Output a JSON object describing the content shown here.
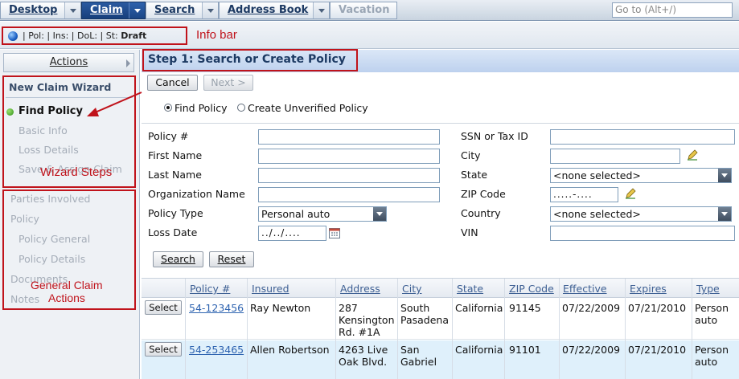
{
  "tabs": [
    {
      "label": "Desktop",
      "state": "normal"
    },
    {
      "label": "Claim",
      "state": "active"
    },
    {
      "label": "Search",
      "state": "normal"
    },
    {
      "label": "Address Book",
      "state": "normal"
    },
    {
      "label": "Vacation",
      "state": "disabled"
    }
  ],
  "goto": {
    "placeholder": "Go to (Alt+/)"
  },
  "infobar": {
    "text": "| Pol: | Ins: | DoL: | St: ",
    "status": "Draft",
    "callout": "Info bar"
  },
  "sidebar": {
    "actions_label": "Actions",
    "wizard_title": "New Claim Wizard",
    "wizard_steps": [
      "Find Policy",
      "Basic Info",
      "Loss Details",
      "Save & Assign Claim"
    ],
    "wizard_callout": "Wizard Steps",
    "general_items": [
      "Parties Involved",
      "Policy",
      "Policy General",
      "Policy Details",
      "Documents",
      "Notes"
    ],
    "general_callout_line1": "General Claim",
    "general_callout_line2": "Actions"
  },
  "step": {
    "title": "Step 1: Search or Create Policy"
  },
  "buttons": {
    "cancel": "Cancel",
    "next": "Next >",
    "search": "Search",
    "reset": "Reset"
  },
  "mode": {
    "find": "Find Policy",
    "create": "Create Unverified Policy",
    "selected": "find"
  },
  "form": {
    "left_labels": [
      "Policy #",
      "First Name",
      "Last Name",
      "Organization Name",
      "Policy Type",
      "Loss Date"
    ],
    "right_labels": [
      "SSN or Tax ID",
      "City",
      "State",
      "ZIP Code",
      "Country",
      "VIN"
    ],
    "policy_type_value": "Personal auto",
    "loss_date_mask": "../../....",
    "state_value": "<none selected>",
    "zip_mask": ".....-....",
    "country_value": "<none selected>"
  },
  "results": {
    "columns": [
      "Policy #",
      "Insured",
      "Address",
      "City",
      "State",
      "ZIP Code",
      "Effective",
      "Expires",
      "Type"
    ],
    "select_label": "Select",
    "rows": [
      {
        "policy": "54-123456",
        "insured": "Ray Newton",
        "address": [
          "287",
          "Kensington",
          "Rd. #1A"
        ],
        "city": [
          "South",
          "Pasadena"
        ],
        "state": "California",
        "zip": "91145",
        "effective": "07/22/2009",
        "expires": "07/21/2010",
        "type": [
          "Person",
          "auto"
        ]
      },
      {
        "policy": "54-253465",
        "insured": "Allen Robertson",
        "address": [
          "4263 Live",
          "Oak Blvd."
        ],
        "city": [
          "San",
          "Gabriel"
        ],
        "state": "California",
        "zip": "91101",
        "effective": "07/22/2009",
        "expires": "07/21/2010",
        "type": [
          "Person",
          "auto"
        ]
      }
    ]
  },
  "colors": {
    "callout": "#c0131b",
    "active_tab": "#1f4b8e",
    "header": "#c9d9f0",
    "selected_row": "#dff0fb"
  }
}
